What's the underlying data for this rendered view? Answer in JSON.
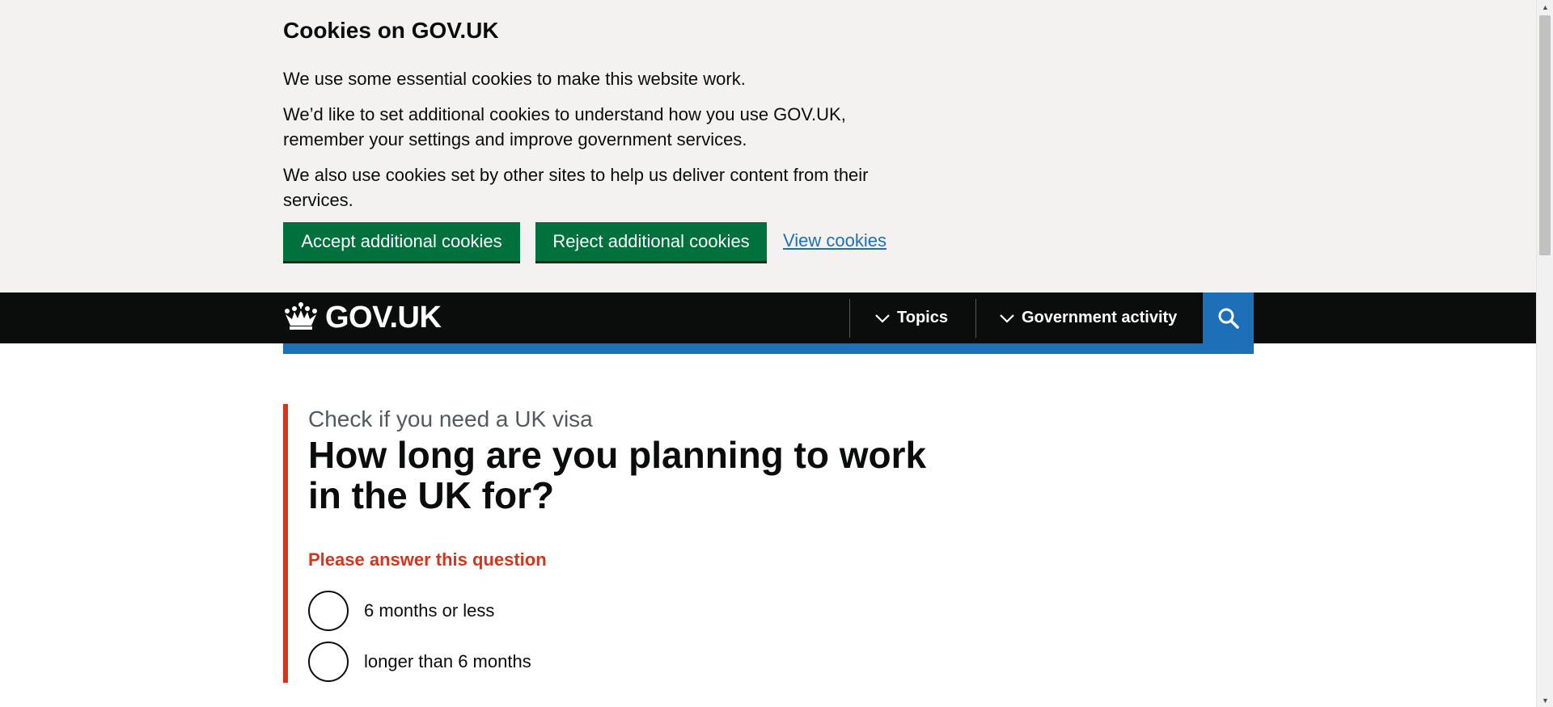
{
  "cookie_banner": {
    "title": "Cookies on GOV.UK",
    "paragraph_1": "We use some essential cookies to make this website work.",
    "paragraph_2": "We’d like to set additional cookies to understand how you use GOV.UK, remember your settings and improve government services.",
    "paragraph_3": "We also use cookies set by other sites to help us deliver content from their services.",
    "accept_label": "Accept additional cookies",
    "reject_label": "Reject additional cookies",
    "view_label": "View cookies"
  },
  "header": {
    "logo_text": "GOV.UK",
    "logo_icon": "crown-icon",
    "nav": [
      {
        "label": "Topics",
        "icon": "chevron-down-icon"
      },
      {
        "label": "Government activity",
        "icon": "chevron-down-icon"
      }
    ],
    "search_icon": "search-icon"
  },
  "question": {
    "caption": "Check if you need a UK visa",
    "title": "How long are you planning to work in the UK for?",
    "error": "Please answer this question",
    "options": [
      {
        "label": "6 months or less",
        "selected": false
      },
      {
        "label": "longer than 6 months",
        "selected": false
      }
    ]
  },
  "colors": {
    "banner_bg": "#f3f2f1",
    "header_bg": "#0b0c0c",
    "brand_blue": "#1d70b8",
    "button_green": "#00703c",
    "error_red": "#d4351c",
    "caption_grey": "#505a5f"
  }
}
